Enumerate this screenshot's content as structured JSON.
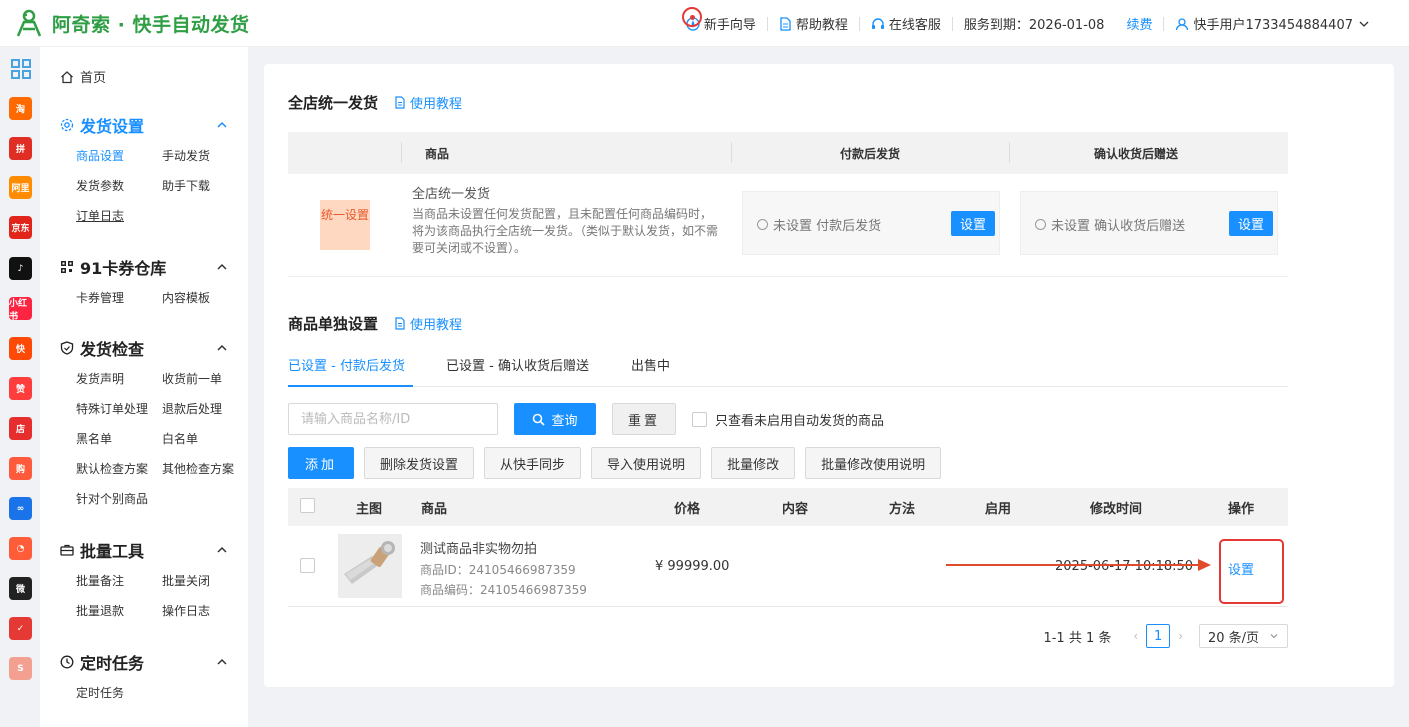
{
  "app": {
    "title": "阿奇索 · 快手自动发货"
  },
  "topnav": {
    "guide": "新手向导",
    "help": "帮助教程",
    "service": "在线客服",
    "expiry": "服务到期：2026-01-08",
    "renew": "续费",
    "user": "快手用户1733454884407"
  },
  "platforms": [
    {
      "name": "app-grid-icon",
      "label": "",
      "color": "#4aa3df"
    },
    {
      "name": "taobao-icon",
      "label": "淘",
      "color": "#ff6a00"
    },
    {
      "name": "pinduoduo-icon",
      "label": "拼",
      "color": "#e02e24"
    },
    {
      "name": "1688-icon",
      "label": "阿里",
      "color": "#ff8c00"
    },
    {
      "name": "jd-icon",
      "label": "京东",
      "color": "#e1251b"
    },
    {
      "name": "douyin-icon",
      "label": "♪",
      "color": "#111111"
    },
    {
      "name": "xiaohongshu-icon",
      "label": "小红书",
      "color": "#ff2442"
    },
    {
      "name": "kuaishou-icon",
      "label": "快",
      "color": "#ff4906"
    },
    {
      "name": "thumb-icon",
      "label": "赞",
      "color": "#ff3d3d"
    },
    {
      "name": "shop-icon",
      "label": "店",
      "color": "#e62e2e"
    },
    {
      "name": "bag-icon",
      "label": "购",
      "color": "#ff5a3c"
    },
    {
      "name": "link-icon",
      "label": "∞",
      "color": "#1a73e8"
    },
    {
      "name": "face-icon",
      "label": "◔",
      "color": "#ff5c39"
    },
    {
      "name": "weidian-icon",
      "label": "微",
      "color": "#222222"
    },
    {
      "name": "checkmark-app-icon",
      "label": "✓",
      "color": "#e53935"
    },
    {
      "name": "shopee-icon",
      "label": "S",
      "color": "#f4a090"
    }
  ],
  "sidebar": {
    "home": "首页",
    "groups": [
      {
        "title": "发货设置",
        "items": [
          "商品设置",
          "手动发货",
          "发货参数",
          "助手下载",
          "订单日志"
        ]
      },
      {
        "title": "91卡券仓库",
        "items": [
          "卡券管理",
          "内容模板"
        ]
      },
      {
        "title": "发货检查",
        "items": [
          "发货声明",
          "收货前一单",
          "特殊订单处理",
          "退款后处理",
          "黑名单",
          "白名单",
          "默认检查方案",
          "其他检查方案",
          "针对个别商品"
        ]
      },
      {
        "title": "批量工具",
        "items": [
          "批量备注",
          "批量关闭",
          "批量退款",
          "操作日志"
        ]
      },
      {
        "title": "定时任务",
        "items": [
          "定时任务"
        ]
      }
    ]
  },
  "unified": {
    "title": "全店统一发货",
    "tutorial": "使用教程",
    "headers": [
      "商品",
      "付款后发货",
      "确认收货后赠送"
    ],
    "badge": "统一设置",
    "desc_title": "全店统一发货",
    "desc": "当商品未设置任何发货配置，且未配置任何商品编码时，将为该商品执行全店统一发货。（类似于默认发货，如不需要可关闭或不设置）。",
    "pay_status": "未设置 付款后发货",
    "gift_status": "未设置 确认收货后赠送",
    "set_label": "设置"
  },
  "single": {
    "title": "商品单独设置",
    "tutorial": "使用教程",
    "tabs": [
      "已设置 - 付款后发货",
      "已设置 - 确认收货后赠送",
      "出售中"
    ],
    "search_placeholder": "请输入商品名称/ID",
    "query": "查询",
    "reset": "重置",
    "only_disabled": "只查看未启用自动发货的商品",
    "actions": [
      "添加",
      "删除发货设置",
      "从快手同步",
      "导入使用说明",
      "批量修改",
      "批量修改使用说明"
    ],
    "columns": [
      "主图",
      "商品",
      "价格",
      "内容",
      "方法",
      "启用",
      "修改时间",
      "操作"
    ],
    "rows": [
      {
        "name": "测试商品非实物勿拍",
        "product_id": "商品ID：24105466987359",
        "product_code": "商品编码：24105466987359",
        "price": "¥ 99999.00",
        "content": "",
        "method": "",
        "enabled": "",
        "modified": "2025-06-17 10:18:50",
        "op": "设置"
      }
    ],
    "pagination": {
      "total": "1-1 共 1 条",
      "page": "1",
      "size": "20 条/页"
    }
  },
  "colors": {
    "brand": "#2f9e44",
    "primary": "#1890ff",
    "highlight": "#e53935"
  }
}
